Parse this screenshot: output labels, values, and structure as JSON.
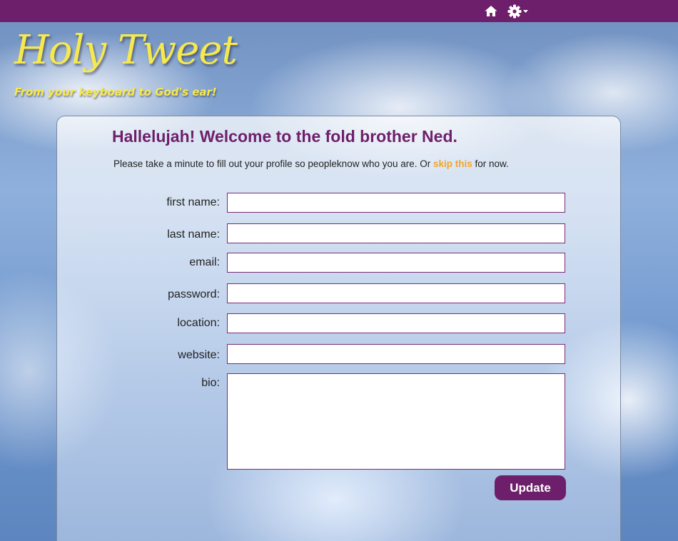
{
  "header": {
    "home_icon": "home-icon",
    "settings_icon": "gear-icon"
  },
  "brand": {
    "logo": "Holy Tweet",
    "tagline": "From your keyboard to God's ear!"
  },
  "form": {
    "welcome": "Hallelujah! Welcome to the fold brother Ned.",
    "intro_before": "Please take a minute  to fill out your profile so peopleknow who you are.  Or ",
    "skip_link": "skip this",
    "intro_after": " for now.",
    "labels": {
      "first_name": "first name:",
      "last_name": "last name:",
      "email": "email:",
      "password": "password:",
      "location": "location:",
      "website": "website:",
      "bio": "bio:"
    },
    "values": {
      "first_name": "",
      "last_name": "",
      "email": "",
      "password": "",
      "location": "",
      "website": "",
      "bio": ""
    },
    "submit": "Update"
  },
  "colors": {
    "brand_purple": "#6e1f6b",
    "logo_yellow": "#f6e94e",
    "link_orange": "#f2a527"
  }
}
